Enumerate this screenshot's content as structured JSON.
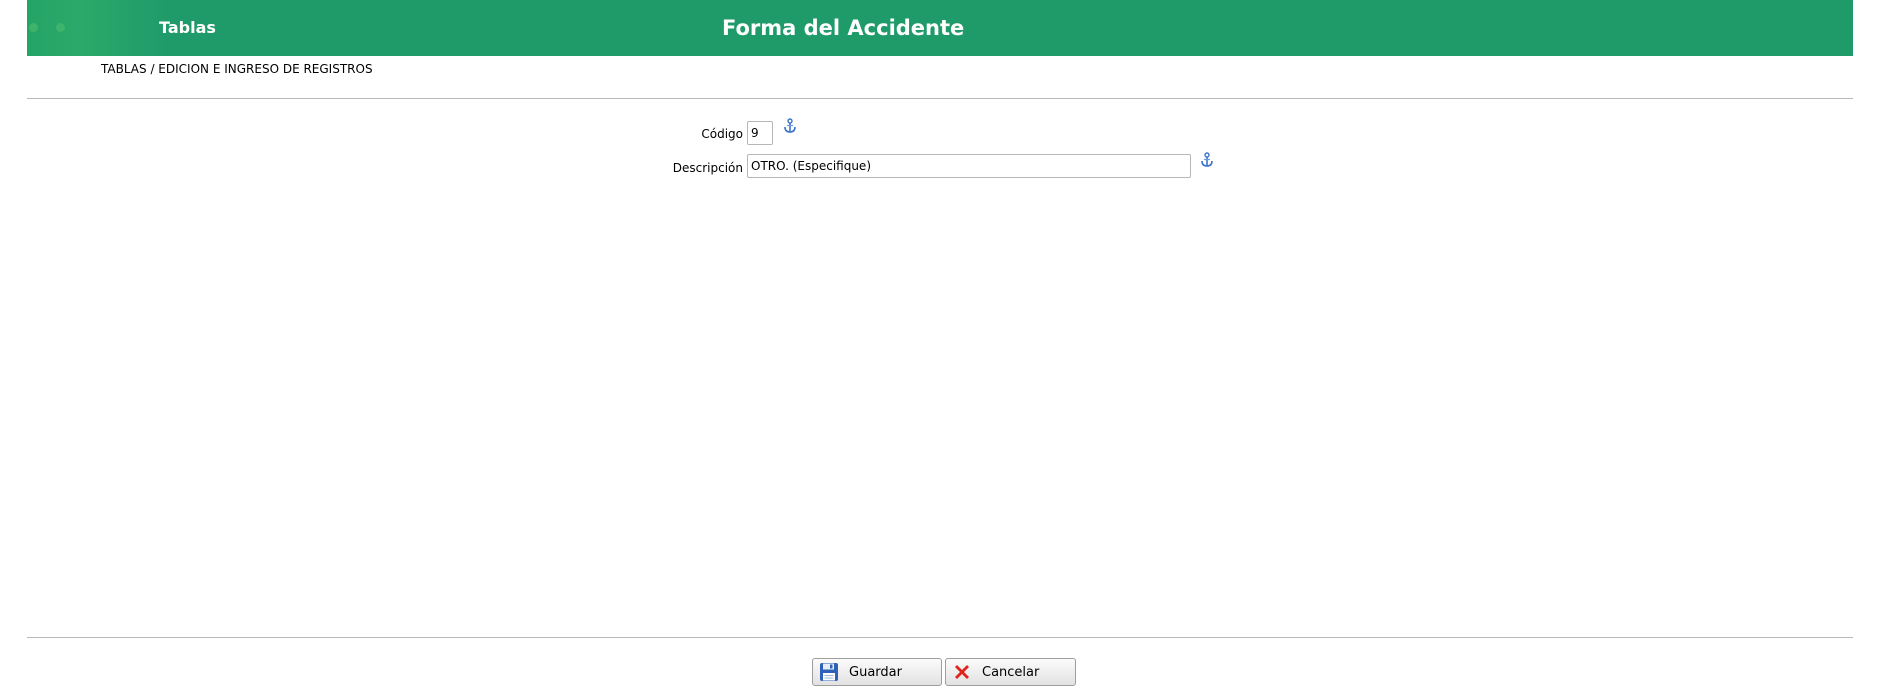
{
  "header": {
    "section": "Tablas",
    "title": "Forma del Accidente",
    "color": "#1f9b6a"
  },
  "breadcrumb": "TABLAS / EDICION E INGRESO DE REGISTROS",
  "form": {
    "codigo": {
      "label": "Código",
      "value": "9",
      "icon": "anchor-icon"
    },
    "descripcion": {
      "label": "Descripción",
      "value": "OTRO. (Especifique)",
      "icon": "anchor-icon"
    }
  },
  "buttons": {
    "save": {
      "label": "Guardar",
      "icon": "floppy-disk-icon"
    },
    "cancel": {
      "label": "Cancelar",
      "icon": "red-x-icon"
    }
  }
}
